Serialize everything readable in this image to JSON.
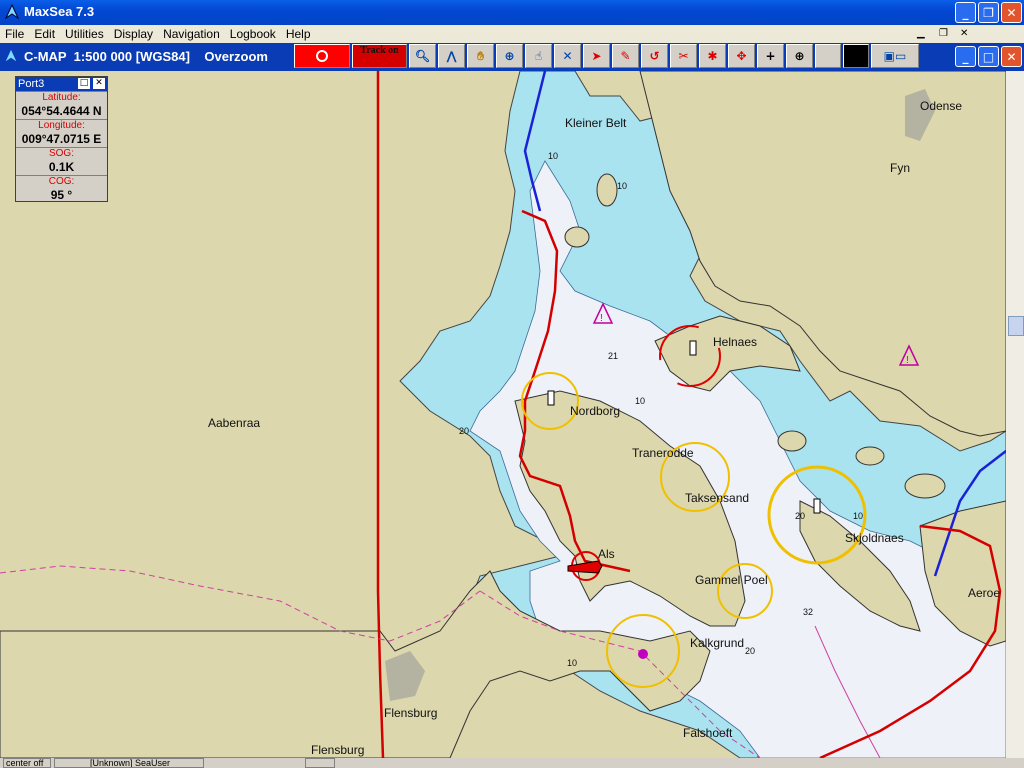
{
  "window": {
    "title": "MaxSea 7.3"
  },
  "menu": [
    "File",
    "Edit",
    "Utilities",
    "Display",
    "Navigation",
    "Logbook",
    "Help"
  ],
  "chart_header": {
    "text": "C-MAP  1:500 000 [WGS84]    Overzoom"
  },
  "toolbar": {
    "track_label": "Track on"
  },
  "port_panel": {
    "title": "Port3",
    "latitude_label": "Latitude:",
    "latitude_value": "054°54.4644 N",
    "longitude_label": "Longitude:",
    "longitude_value": "009°47.0715 E",
    "sog_label": "SOG:",
    "sog_value": "0.1K",
    "cog_label": "COG:",
    "cog_value": "95 °"
  },
  "map_labels": {
    "kleiner_belt": "Kleiner Belt",
    "odense": "Odense",
    "fyn": "Fyn",
    "helnaes": "Helnaes",
    "nordborg": "Nordborg",
    "tranerodde": "Tranerodde",
    "aabenraa": "Aabenraa",
    "taksensand": "Taksensand",
    "skjoldnaes": "Skjoldnaes",
    "als": "Als",
    "gammel_poel": "Gammel Poel",
    "aeroe": "Aeroe",
    "kalkgrund": "Kalkgrund",
    "flensburg1": "Flensburg",
    "flensburg2": "Flensburg",
    "falshoeft": "Falshoeft"
  },
  "depths": {
    "d21": "21",
    "d32": "32",
    "d20a": "20",
    "d20b": "20",
    "d20c": "20",
    "d10a": "10",
    "d10b": "10",
    "d10c": "10",
    "d10d": "10",
    "d10e": "10"
  },
  "status": {
    "center": "center off",
    "user": "[Unknown] SeaUser"
  },
  "colors": {
    "land": "#dcd7ac",
    "shallow": "#a9e3ef",
    "deep": "#eef1f7",
    "track": "#d40000",
    "route": "#1a22d8"
  }
}
